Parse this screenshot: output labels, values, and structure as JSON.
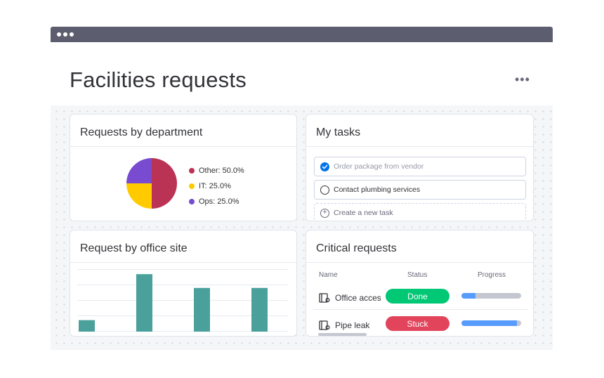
{
  "page": {
    "title": "Facilities requests",
    "more_label": "•••"
  },
  "widgets": {
    "department": {
      "title": "Requests by department",
      "legend": [
        {
          "label": "Other: 50.0%",
          "color": "#bb3354"
        },
        {
          "label": "IT: 25.0%",
          "color": "#ffcb00"
        },
        {
          "label": "Ops: 25.0%",
          "color": "#784bd1"
        }
      ]
    },
    "tasks": {
      "title": "My tasks",
      "items": [
        {
          "label": "Order package from vendor",
          "done": true
        },
        {
          "label": "Contact plumbing services",
          "done": false
        }
      ],
      "new_task_label": "Create a new task"
    },
    "office_site": {
      "title": "Request by office site"
    },
    "critical": {
      "title": "Critical requests",
      "columns": {
        "name": "Name",
        "status": "Status",
        "progress": "Progress"
      },
      "rows": [
        {
          "name": "Office access",
          "status": "Done",
          "status_color": "#00c875",
          "progress": 0.23
        },
        {
          "name": "Pipe leak",
          "status": "Stuck",
          "status_color": "#e2445c",
          "progress": 0.93
        }
      ]
    }
  },
  "chart_data": {
    "type": "pie",
    "slices": [
      {
        "label": "Other",
        "value": 50.0,
        "color": "#bb3354"
      },
      {
        "label": "IT",
        "value": 25.0,
        "color": "#ffcb00"
      },
      {
        "label": "Ops",
        "value": 25.0,
        "color": "#784bd1"
      }
    ]
  },
  "bar_chart": {
    "type": "bar",
    "values": [
      1,
      5,
      3.8,
      3.8
    ],
    "ylim": [
      0,
      5.5
    ],
    "color": "#4aa19b"
  }
}
